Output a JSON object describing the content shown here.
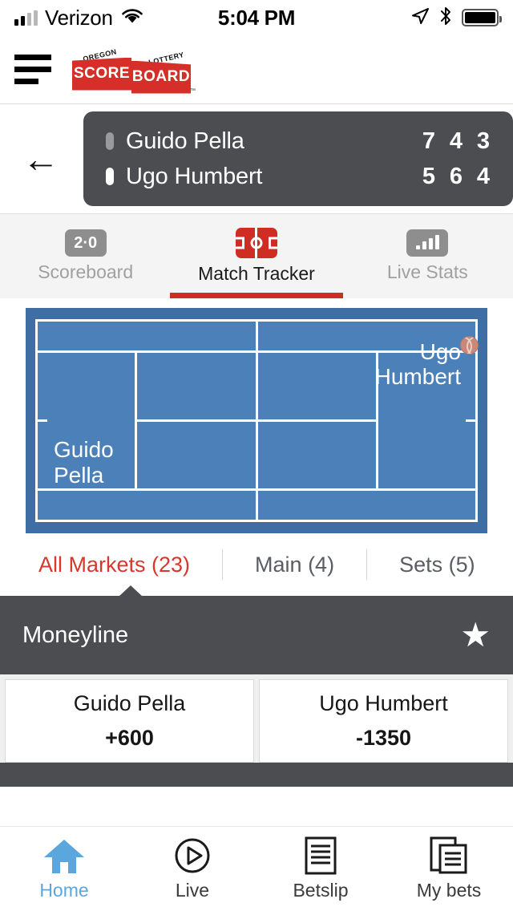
{
  "status_bar": {
    "carrier": "Verizon",
    "time": "5:04 PM",
    "signal_icon": "signal-bars-icon",
    "wifi_icon": "wifi-icon",
    "location_icon": "location-arrow-icon",
    "bluetooth_icon": "bluetooth-icon",
    "battery_icon": "battery-full-icon"
  },
  "app_header": {
    "menu_icon": "hamburger-menu-icon",
    "logo": {
      "top_left": "OREGON",
      "top_right": "LOTTERY",
      "word_left": "SCORE",
      "word_right": "BOARD",
      "trademark": "™"
    }
  },
  "match": {
    "back_icon": "back-arrow-icon",
    "players": [
      {
        "name": "Guido Pella",
        "serving": false,
        "sets": [
          "7",
          "4",
          "3"
        ]
      },
      {
        "name": "Ugo Humbert",
        "serving": true,
        "sets": [
          "5",
          "6",
          "4"
        ]
      }
    ]
  },
  "view_tabs": [
    {
      "label": "Scoreboard",
      "icon": "scoreboard-badge-icon",
      "badge": "2·0",
      "active": false
    },
    {
      "label": "Match Tracker",
      "icon": "pitch-icon",
      "active": true
    },
    {
      "label": "Live Stats",
      "icon": "bar-chart-icon",
      "active": false
    }
  ],
  "court": {
    "left_player": "Guido\nPella",
    "right_player": "Ugo\nHumbert",
    "ball_icon": "tennis-ball-icon",
    "surface_color": "#4b80b8",
    "line_color": "#ffffff"
  },
  "market_tabs": [
    {
      "label": "All Markets (23)",
      "active": true
    },
    {
      "label": "Main (4)",
      "active": false
    },
    {
      "label": "Sets (5)",
      "active": false
    }
  ],
  "market": {
    "title": "Moneyline",
    "favorite_icon": "star-icon",
    "selections": [
      {
        "name": "Guido Pella",
        "price": "+600"
      },
      {
        "name": "Ugo Humbert",
        "price": "-1350"
      }
    ]
  },
  "bottom_nav": [
    {
      "label": "Home",
      "icon": "home-icon",
      "active": true
    },
    {
      "label": "Live",
      "icon": "play-circle-icon",
      "active": false
    },
    {
      "label": "Betslip",
      "icon": "betslip-document-icon",
      "active": false
    },
    {
      "label": "My bets",
      "icon": "my-bets-documents-icon",
      "active": false
    }
  ],
  "colors": {
    "accent_red": "#cf2c24",
    "dark_gray": "#4c4d50",
    "court_blue": "#4b80b8",
    "active_blue": "#5aa6dd"
  }
}
